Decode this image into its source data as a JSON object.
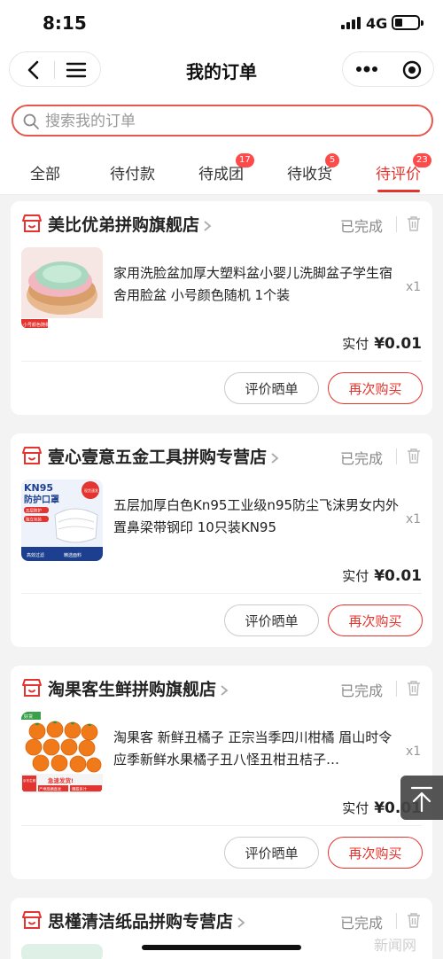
{
  "status_bar": {
    "time": "8:15",
    "network": "4G"
  },
  "nav": {
    "title": "我的订单"
  },
  "search": {
    "placeholder": "搜索我的订单"
  },
  "tabs": [
    {
      "label": "全部",
      "badge": ""
    },
    {
      "label": "待付款",
      "badge": ""
    },
    {
      "label": "待成团",
      "badge": "17"
    },
    {
      "label": "待收货",
      "badge": "5"
    },
    {
      "label": "待评价",
      "badge": "23",
      "active": true
    }
  ],
  "orders": [
    {
      "shop": "美比优弟拼购旗舰店",
      "status": "已完成",
      "product_title": "家用洗脸盆加厚大塑料盆小婴儿洗脚盆子学生宿舍用脸盆 小号颜色随机 1个装",
      "image_caption": "小号颜色随机 26cm*9cm",
      "qty": "x1",
      "paid_label": "实付",
      "amount": "¥0.01",
      "review_label": "评价晒单",
      "rebuy_label": "再次购买"
    },
    {
      "shop": "壹心壹意五金工具拼购专营店",
      "status": "已完成",
      "product_title": "五层加厚白色Kn95工业级n95防尘飞沫男女内外置鼻梁带钢印 10只装KN95",
      "image_text": {
        "title1": "KN95",
        "title2": "防护口罩",
        "tag": "现货速发",
        "l1": "五层防护",
        "l2": "独立包装",
        "l3": "高效过滤",
        "l4": "精选面料"
      },
      "qty": "x1",
      "paid_label": "实付",
      "amount": "¥0.01",
      "review_label": "评价晒单",
      "rebuy_label": "再次购买"
    },
    {
      "shop": "淘果客生鲜拼购旗舰店",
      "status": "已完成",
      "product_title": "淘果客 新鲜丑橘子 正宗当季四川柑橘 眉山时令应季新鲜水果橘子丑八怪丑柑丑桔子…",
      "image_text": {
        "top": "好货",
        "brand": "京东生鲜",
        "slogan": "急速发货!",
        "s1": "产地现摘直发",
        "s2": "爆甜多汁"
      },
      "qty": "x1",
      "paid_label": "实付",
      "amount": "¥0.01",
      "review_label": "评价晒单",
      "rebuy_label": "再次购买"
    },
    {
      "shop": "思槿清洁纸品拼购专营店",
      "status": "已完成"
    }
  ],
  "watermark": "新闻网",
  "colors": {
    "accent": "#e3342f",
    "badge": "#ff4a4a",
    "background": "#f3f3f3"
  },
  "icons": [
    "back-icon",
    "menu-icon",
    "more-icon",
    "target-icon",
    "search-icon",
    "shop-icon",
    "chevron-right-icon",
    "trash-icon",
    "arrow-up-icon"
  ]
}
